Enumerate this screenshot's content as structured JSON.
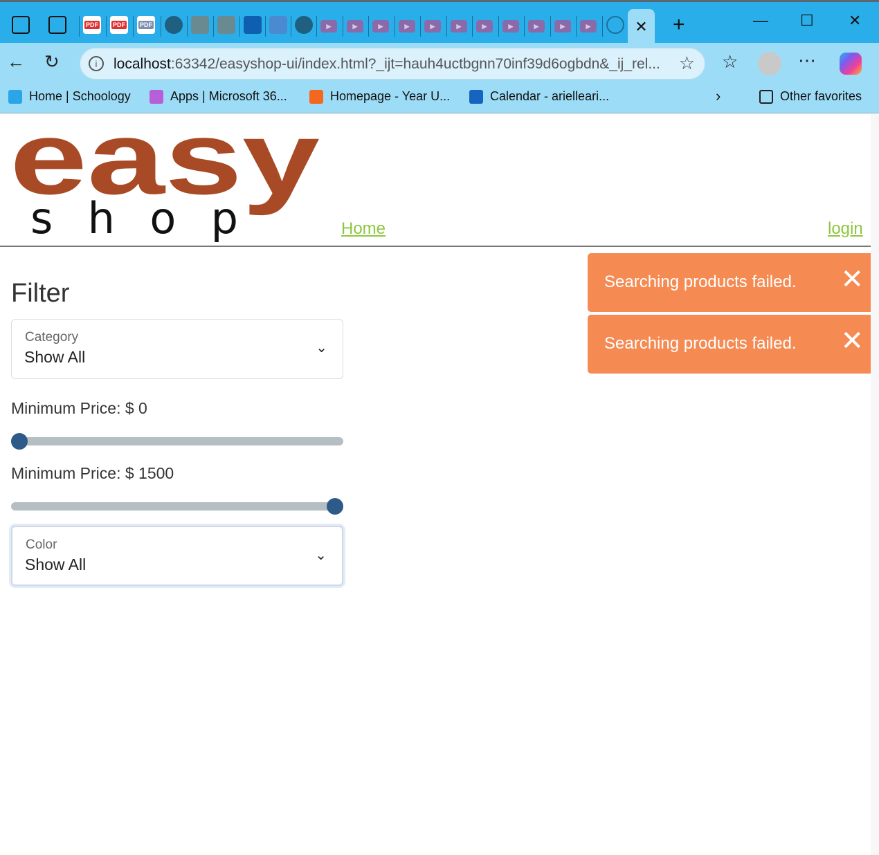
{
  "browser": {
    "tab_icons": [
      "workspaces-icon",
      "tab-actions-icon",
      "pdf-icon",
      "pdf-icon",
      "pdf-icon",
      "github-icon",
      "yellow-y-icon",
      "yellow-y-icon",
      "office-icon",
      "teams-icon",
      "chatgpt-icon",
      "youtube-icon",
      "youtube-icon",
      "youtube-icon",
      "youtube-icon",
      "youtube-icon",
      "youtube-icon",
      "youtube-icon",
      "youtube-icon",
      "youtube-icon",
      "youtube-icon",
      "youtube-icon",
      "globe-icon"
    ],
    "pdf_label": "PDF",
    "url_host": "localhost",
    "url_rest": ":63342/easyshop-ui/index.html?_ijt=hauh4uctbgnn70inf39d6ogbdn&_ij_rel...",
    "favorites": [
      {
        "label": "Home | Schoology",
        "color": "#2aa5e8"
      },
      {
        "label": "Apps | Microsoft 36...",
        "color": "#b65fd8"
      },
      {
        "label": "Homepage - Year U...",
        "color": "#f5661f"
      },
      {
        "label": "Calendar - arielleari...",
        "color": "#1664c0"
      }
    ],
    "other_favorites": "Other favorites"
  },
  "header": {
    "logo_top": "easy",
    "logo_bottom": "s h o p",
    "home_link": "Home",
    "login_link": "login"
  },
  "filter": {
    "title": "Filter",
    "category": {
      "label": "Category",
      "value": "Show All"
    },
    "min_price": {
      "label": "Minimum Price: $ 0",
      "value": 0
    },
    "max_price": {
      "label": "Minimum Price: $ 1500",
      "value": 1500
    },
    "price_range": [
      0,
      1500
    ],
    "color": {
      "label": "Color",
      "value": "Show All"
    }
  },
  "toasts": [
    {
      "message": "Searching products failed."
    },
    {
      "message": "Searching products failed."
    }
  ],
  "colors": {
    "brand": "#a84a26",
    "link": "#8dc63f",
    "toast": "#f58a52",
    "slider_thumb": "#2e5a8a"
  }
}
